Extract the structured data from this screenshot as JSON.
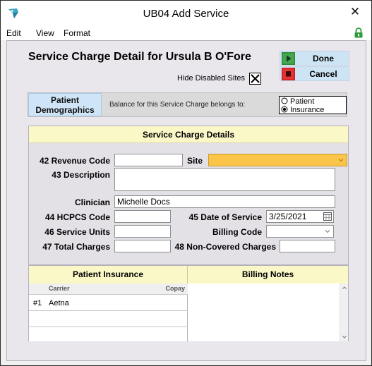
{
  "window": {
    "title": "UB04 Add Service"
  },
  "menu": {
    "items": [
      "Edit",
      "View",
      "Format"
    ]
  },
  "header": {
    "title": "Service Charge Detail for Ursula B O'Fore"
  },
  "hide_disabled_sites": {
    "label": "Hide Disabled Sites",
    "checked": true
  },
  "actions": {
    "done": "Done",
    "cancel": "Cancel"
  },
  "tabs": {
    "patient_demographics_line1": "Patient",
    "patient_demographics_line2": "Demographics"
  },
  "balance": {
    "label": "Balance for this Service Charge belongs to:",
    "options": [
      "Patient",
      "Insurance"
    ],
    "selected": "Insurance"
  },
  "details": {
    "section_title": "Service Charge Details",
    "revenue_code": {
      "label": "42  Revenue Code",
      "value": ""
    },
    "site": {
      "label": "Site",
      "value": ""
    },
    "description": {
      "label": "43  Description",
      "value": ""
    },
    "clinician": {
      "label": "Clinician",
      "value": "Michelle Docs"
    },
    "hcpcs_code": {
      "label": "44  HCPCS Code",
      "value": ""
    },
    "date_of_service": {
      "label": "45  Date of Service",
      "value": "3/25/2021"
    },
    "service_units": {
      "label": "46  Service Units",
      "value": ""
    },
    "billing_code": {
      "label": "Billing Code",
      "value": ""
    },
    "total_charges": {
      "label": "47  Total Charges",
      "value": ""
    },
    "non_covered_charges": {
      "label": "48 Non-Covered Charges",
      "value": ""
    }
  },
  "insurance": {
    "title": "Patient Insurance",
    "columns": [
      "Carrier",
      "Copay"
    ],
    "rows": [
      {
        "num": "#1",
        "carrier": "Aetna",
        "copay": ""
      }
    ]
  },
  "notes": {
    "title": "Billing Notes",
    "value": ""
  },
  "colors": {
    "section_header": "#fbf8c8",
    "site_field": "#fbc54a",
    "button_bg": "#cde4f5",
    "tab_active": "#cfe5f7"
  }
}
